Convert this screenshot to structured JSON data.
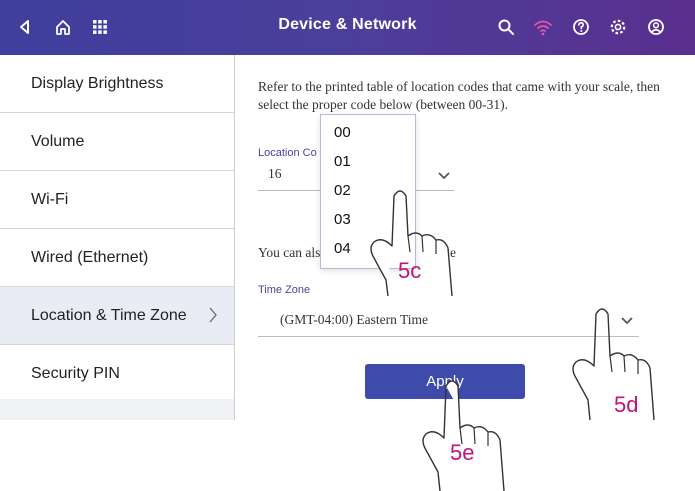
{
  "header": {
    "title": "Device & Network",
    "left_icons": [
      "back-icon",
      "home-icon",
      "apps-grid-icon"
    ],
    "right_icons": [
      "search-icon",
      "wifi-icon",
      "help-icon",
      "settings-icon",
      "account-icon"
    ]
  },
  "sidebar": {
    "items": [
      {
        "label": "Display Brightness",
        "active": false
      },
      {
        "label": "Volume",
        "active": false
      },
      {
        "label": "Wi-Fi",
        "active": false
      },
      {
        "label": "Wired (Ethernet)",
        "active": false
      },
      {
        "label": "Location & Time Zone",
        "active": true
      },
      {
        "label": "Security PIN",
        "active": false
      }
    ]
  },
  "main": {
    "description": "Refer to the printed table of location codes that came with your scale, then select the proper code below (between 00-31).",
    "location_code": {
      "label": "Location Co",
      "value": "16",
      "options": [
        "00",
        "01",
        "02",
        "03",
        "04"
      ]
    },
    "secondary_text_start": "You can als",
    "secondary_text_end": "e",
    "time_zone": {
      "label": "Time Zone",
      "value": "(GMT-04:00) Eastern Time"
    },
    "apply_label": "Apply"
  },
  "annotations": {
    "step_5c": "5c",
    "step_5d": "5d",
    "step_5e": "5e"
  },
  "colors": {
    "header_start": "#3f3f9d",
    "header_end": "#5a2f8f",
    "accent": "#4b3f9a",
    "apply_button": "#3f4bab",
    "annotation": "#c0157a",
    "active_item": "#e9ecf5"
  }
}
